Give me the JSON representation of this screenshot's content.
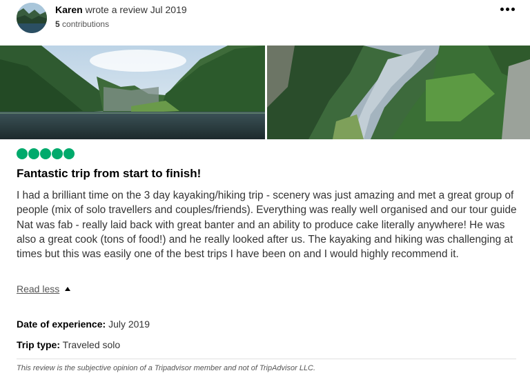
{
  "review": {
    "author": "Karen",
    "action_text": "wrote a review Jul 2019",
    "contributions_count": "5",
    "contributions_label": "contributions",
    "rating": 5,
    "rating_max": 5,
    "title": "Fantastic trip from start to finish!",
    "body": "I had a brilliant time on the 3 day kayaking/hiking trip - scenery was just amazing and met a great group of people (mix of solo travellers and couples/friends). Everything was really well organised and our tour guide Nat was fab - really laid back with great banter and an ability to produce cake literally anywhere! He was also a great cook (tons of food!) and he really looked after us. The kayaking and hiking was challenging at times but this was easily one of the best trips I have been on and I would highly recommend it.",
    "read_less_label": "Read less",
    "date_of_experience_label": "Date of experience:",
    "date_of_experience_value": "July 2019",
    "trip_type_label": "Trip type:",
    "trip_type_value": "Traveled solo",
    "disclaimer": "This review is the subjective opinion of a Tripadvisor member and not of TripAdvisor LLC."
  },
  "colors": {
    "rating_bubble": "#00aa6c",
    "text_primary": "#000000",
    "text_body": "#333333",
    "text_muted": "#555555",
    "divider": "#e0e0e0"
  },
  "icons": {
    "more": "more-dots-icon",
    "collapse": "caret-up-icon"
  }
}
